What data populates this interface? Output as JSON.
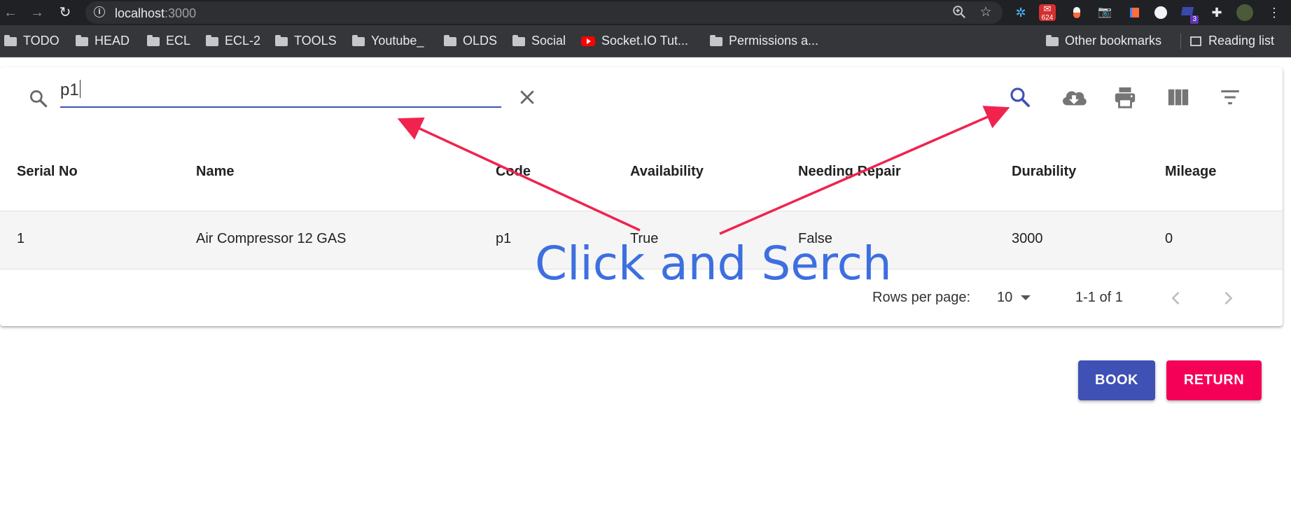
{
  "browser": {
    "url_host": "localhost",
    "url_port": ":3000",
    "extension_badges": {
      "mail_count": "624",
      "ext_count": "3"
    },
    "bookmarks": [
      {
        "label": "TODO",
        "icon": "folder-icon"
      },
      {
        "label": "HEAD",
        "icon": "folder-icon"
      },
      {
        "label": "ECL",
        "icon": "folder-icon"
      },
      {
        "label": "ECL-2",
        "icon": "folder-icon"
      },
      {
        "label": "TOOLS",
        "icon": "folder-icon"
      },
      {
        "label": "Youtube_",
        "icon": "folder-icon"
      },
      {
        "label": "OLDS",
        "icon": "folder-icon"
      },
      {
        "label": "Social",
        "icon": "folder-icon"
      },
      {
        "label": "Socket.IO Tut...",
        "icon": "youtube-icon"
      },
      {
        "label": "Permissions a...",
        "icon": "folder-icon"
      }
    ],
    "other_bookmarks": "Other bookmarks",
    "reading_list": "Reading list"
  },
  "search": {
    "value": "p1"
  },
  "table": {
    "columns": [
      "Serial No",
      "Name",
      "Code",
      "Availability",
      "Needing Repair",
      "Durability",
      "Mileage"
    ],
    "rows": [
      [
        "1",
        "Air Compressor 12 GAS",
        "p1",
        "True",
        "False",
        "3000",
        "0"
      ]
    ]
  },
  "pagination": {
    "rows_per_page_label": "Rows per page:",
    "rows_per_page_value": "10",
    "range": "1-1 of 1"
  },
  "actions": {
    "book_label": "BOOK",
    "return_label": "RETURN"
  },
  "annotation": {
    "text": "Click and Serch",
    "color": "#3d6fe0",
    "arrow_color": "#f0234f"
  },
  "colors": {
    "primary": "#3f51b5",
    "secondary": "#f50057"
  }
}
